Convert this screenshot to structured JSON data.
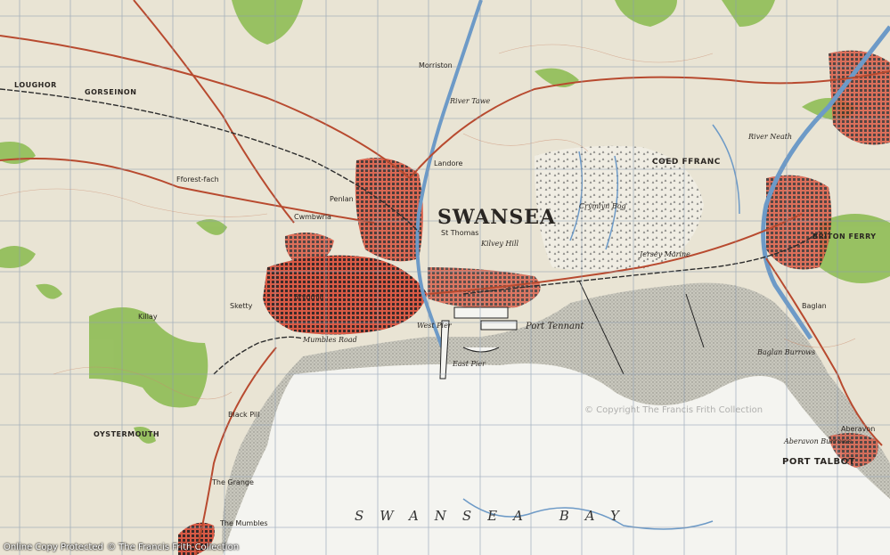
{
  "map": {
    "title": "SWANSEA",
    "bay_label": "SWANSEA BAY",
    "watermark": "© Copyright The Francis Frith Collection",
    "footer_left": "Online Copy Protected",
    "footer_mid": "© The Francis Frith Collection",
    "labels": {
      "port_talbot": "PORT TALBOT",
      "port_tennant": "Port Tennant",
      "coed_ffranc": "COED FFRANC",
      "briton_ferry": "BRITON FERRY",
      "the_mumbles": "The Mumbles",
      "oystermouth": "OYSTERMOUTH",
      "aberavon": "Aberavon",
      "landore": "Landore",
      "morriston": "Morriston",
      "loughor": "LOUGHOR",
      "gorseinon": "GORSEINON",
      "baglan": "Baglan",
      "sketty": "Sketty",
      "mumbles_road": "Mumbles Road",
      "black_pill": "Black Pill",
      "killay": "Killay",
      "east_pier": "East Pier",
      "west_pier": "West Pier",
      "cwm_bwrla": "Cwmbwrla",
      "brynmill": "Brynmill",
      "the_grange": "The Grange",
      "fforestfach": "Fforest-fach",
      "penlan": "Penlan",
      "st_thomas": "St Thomas",
      "kilvey_hill": "Kilvey Hill",
      "crymlyn_bog": "Crymlyn Bog",
      "jersey_marine": "Jersey Marine",
      "baglan_burrows": "Baglan Burrows",
      "aberavon_burrows": "Aberavon Burrows",
      "neath_river": "River Neath",
      "tawe_river": "River Tawe"
    },
    "colors": {
      "sea": "#f2f2ee",
      "sand": "#bcbcb4",
      "land": "#e9e4d4",
      "urban": "#c23a2a",
      "wood": "#8fbd55",
      "river": "#6d9ac7",
      "grid": "#8a9bb0",
      "road": "#b84a2f"
    }
  }
}
